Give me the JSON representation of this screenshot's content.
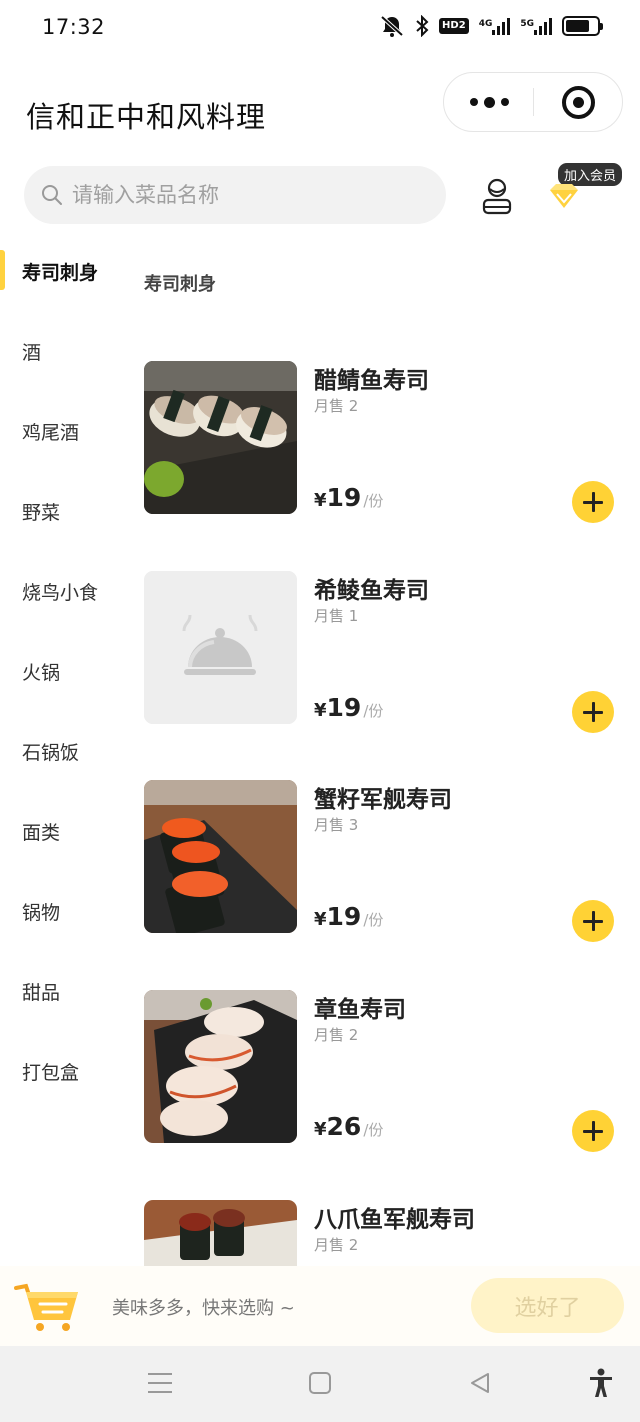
{
  "status_bar": {
    "time": "17:32",
    "icons": [
      "mute-bell-icon",
      "bluetooth-icon",
      "hd-icon",
      "signal-4g-icon",
      "signal-5g-icon",
      "battery-icon"
    ],
    "hd_label": "HD2",
    "net1_label": "4G",
    "net2_label": "5G",
    "battery_level": 0.75
  },
  "header": {
    "title": "信和正中和风料理"
  },
  "search": {
    "placeholder": "请输入菜品名称"
  },
  "member": {
    "badge": "加入会员"
  },
  "sidebar": {
    "items": [
      {
        "label": "寿司刺身",
        "active": true
      },
      {
        "label": "酒",
        "active": false
      },
      {
        "label": "鸡尾酒",
        "active": false
      },
      {
        "label": "野菜",
        "active": false
      },
      {
        "label": "烧鸟小食",
        "active": false
      },
      {
        "label": "火锅",
        "active": false
      },
      {
        "label": "石锅饭",
        "active": false
      },
      {
        "label": "面类",
        "active": false
      },
      {
        "label": "锅物",
        "active": false
      },
      {
        "label": "甜品",
        "active": false
      },
      {
        "label": "打包盒",
        "active": false
      }
    ]
  },
  "content": {
    "section_title": "寿司刺身",
    "items": [
      {
        "name": "醋鲭鱼寿司",
        "sales": "月售 2",
        "currency": "¥",
        "price": "19",
        "unit": "/份",
        "image": "mackerel-sushi-photo"
      },
      {
        "name": "希鲮鱼寿司",
        "sales": "月售 1",
        "currency": "¥",
        "price": "19",
        "unit": "/份",
        "image": "placeholder-cloche-icon"
      },
      {
        "name": "蟹籽军舰寿司",
        "sales": "月售 3",
        "currency": "¥",
        "price": "19",
        "unit": "/份",
        "image": "roe-gunkan-photo"
      },
      {
        "name": "章鱼寿司",
        "sales": "月售 2",
        "currency": "¥",
        "price": "26",
        "unit": "/份",
        "image": "octopus-sushi-photo"
      },
      {
        "name": "八爪鱼军舰寿司",
        "sales": "月售 2",
        "currency": "¥",
        "price": "",
        "unit": "",
        "image": "octopus-gunkan-photo"
      }
    ]
  },
  "cart": {
    "hint": "美味多多，快来选购 ~",
    "checkout_label": "选好了"
  },
  "colors": {
    "accent": "#ffd235",
    "checkout_disabled_bg": "#fff3c8"
  }
}
